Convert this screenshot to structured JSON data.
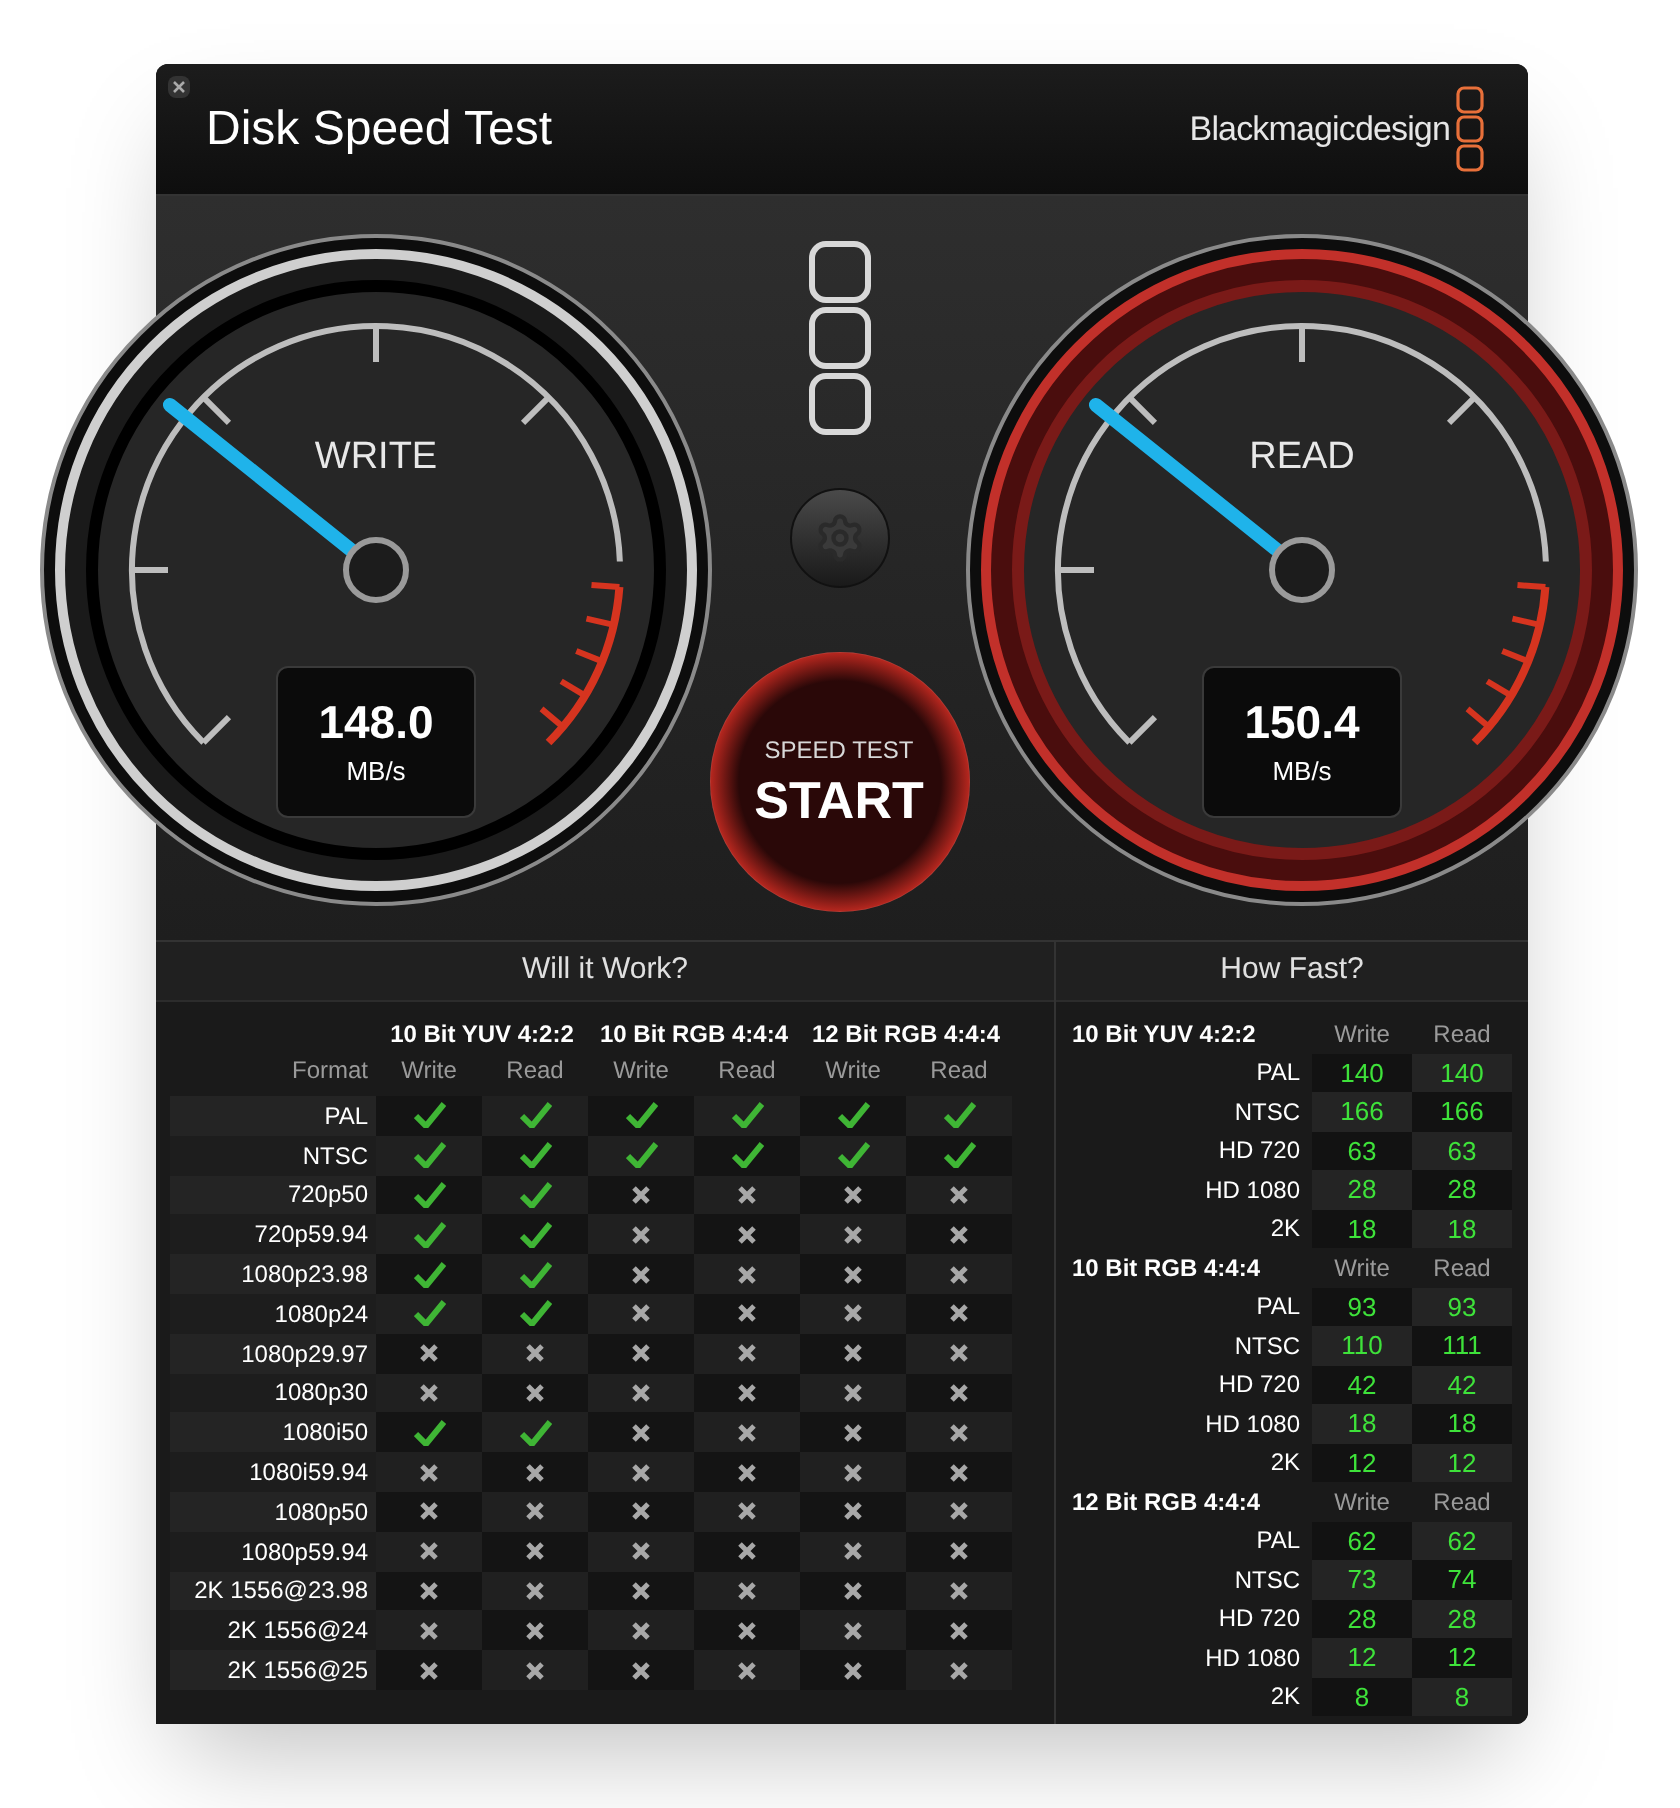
{
  "window": {
    "title": "Disk Speed Test"
  },
  "brand": "Blackmagicdesign",
  "gauges": [
    {
      "label": "WRITE",
      "value": "148.0",
      "unit": "MB/s",
      "level": 0.31,
      "kind": "plain"
    },
    {
      "label": "READ",
      "value": "150.4",
      "unit": "MB/s",
      "level": 0.31,
      "kind": "red"
    }
  ],
  "start_button": {
    "caption": "SPEED TEST",
    "label": "START"
  },
  "will_it_work": {
    "title": "Will it Work?",
    "format_heading": "Format",
    "groups": [
      {
        "name": "10 Bit YUV 4:2:2",
        "columns": [
          "Write",
          "Read"
        ]
      },
      {
        "name": "10 Bit RGB 4:4:4",
        "columns": [
          "Write",
          "Read"
        ]
      },
      {
        "name": "12 Bit RGB 4:4:4",
        "columns": [
          "Write",
          "Read"
        ]
      }
    ],
    "rows": [
      {
        "format": "PAL",
        "results": [
          true,
          true,
          true,
          true,
          true,
          true
        ]
      },
      {
        "format": "NTSC",
        "results": [
          true,
          true,
          true,
          true,
          true,
          true
        ]
      },
      {
        "format": "720p50",
        "results": [
          true,
          true,
          false,
          false,
          false,
          false
        ]
      },
      {
        "format": "720p59.94",
        "results": [
          true,
          true,
          false,
          false,
          false,
          false
        ]
      },
      {
        "format": "1080p23.98",
        "results": [
          true,
          true,
          false,
          false,
          false,
          false
        ]
      },
      {
        "format": "1080p24",
        "results": [
          true,
          true,
          false,
          false,
          false,
          false
        ]
      },
      {
        "format": "1080p29.97",
        "results": [
          false,
          false,
          false,
          false,
          false,
          false
        ]
      },
      {
        "format": "1080p30",
        "results": [
          false,
          false,
          false,
          false,
          false,
          false
        ]
      },
      {
        "format": "1080i50",
        "results": [
          true,
          true,
          false,
          false,
          false,
          false
        ]
      },
      {
        "format": "1080i59.94",
        "results": [
          false,
          false,
          false,
          false,
          false,
          false
        ]
      },
      {
        "format": "1080p50",
        "results": [
          false,
          false,
          false,
          false,
          false,
          false
        ]
      },
      {
        "format": "1080p59.94",
        "results": [
          false,
          false,
          false,
          false,
          false,
          false
        ]
      },
      {
        "format": "2K 1556@23.98",
        "results": [
          false,
          false,
          false,
          false,
          false,
          false
        ]
      },
      {
        "format": "2K 1556@24",
        "results": [
          false,
          false,
          false,
          false,
          false,
          false
        ]
      },
      {
        "format": "2K 1556@25",
        "results": [
          false,
          false,
          false,
          false,
          false,
          false
        ]
      }
    ]
  },
  "how_fast": {
    "title": "How Fast?",
    "groups": [
      {
        "name": "10 Bit YUV 4:2:2",
        "columns": [
          "Write",
          "Read"
        ],
        "rows": [
          {
            "format": "PAL",
            "write": "140",
            "read": "140"
          },
          {
            "format": "NTSC",
            "write": "166",
            "read": "166"
          },
          {
            "format": "HD 720",
            "write": "63",
            "read": "63"
          },
          {
            "format": "HD 1080",
            "write": "28",
            "read": "28"
          },
          {
            "format": "2K",
            "write": "18",
            "read": "18"
          }
        ]
      },
      {
        "name": "10 Bit RGB 4:4:4",
        "columns": [
          "Write",
          "Read"
        ],
        "rows": [
          {
            "format": "PAL",
            "write": "93",
            "read": "93"
          },
          {
            "format": "NTSC",
            "write": "110",
            "read": "111"
          },
          {
            "format": "HD 720",
            "write": "42",
            "read": "42"
          },
          {
            "format": "HD 1080",
            "write": "18",
            "read": "18"
          },
          {
            "format": "2K",
            "write": "12",
            "read": "12"
          }
        ]
      },
      {
        "name": "12 Bit RGB 4:4:4",
        "columns": [
          "Write",
          "Read"
        ],
        "rows": [
          {
            "format": "PAL",
            "write": "62",
            "read": "62"
          },
          {
            "format": "NTSC",
            "write": "73",
            "read": "74"
          },
          {
            "format": "HD 720",
            "write": "28",
            "read": "28"
          },
          {
            "format": "HD 1080",
            "write": "12",
            "read": "12"
          },
          {
            "format": "2K",
            "write": "8",
            "read": "8"
          }
        ]
      }
    ]
  }
}
